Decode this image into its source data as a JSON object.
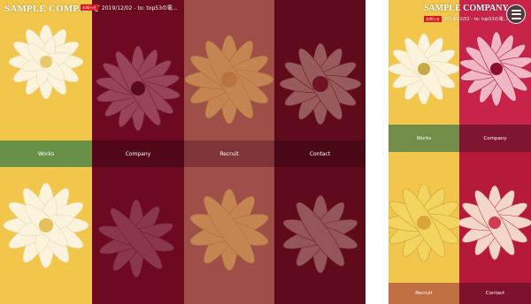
{
  "site": {
    "logo": "SAMPLE COMPANY",
    "news_badge": "お知らせ",
    "news_text": "2019/12/02 - to: top53の電...",
    "mobile_news_text": "2019/12/02 - to: top53の電..."
  },
  "nav": {
    "items": [
      {
        "label": "Works"
      },
      {
        "label": "Company"
      },
      {
        "label": "Recruit"
      },
      {
        "label": "Contact"
      }
    ]
  },
  "colors": {
    "yellow": "#f2c64b",
    "crimson": "#7a0b22",
    "pink_red": "#c8244a",
    "cream": "#f6edd5",
    "band_works": "#5f8f49"
  },
  "icons": {
    "menu": "hamburger-menu-icon"
  }
}
